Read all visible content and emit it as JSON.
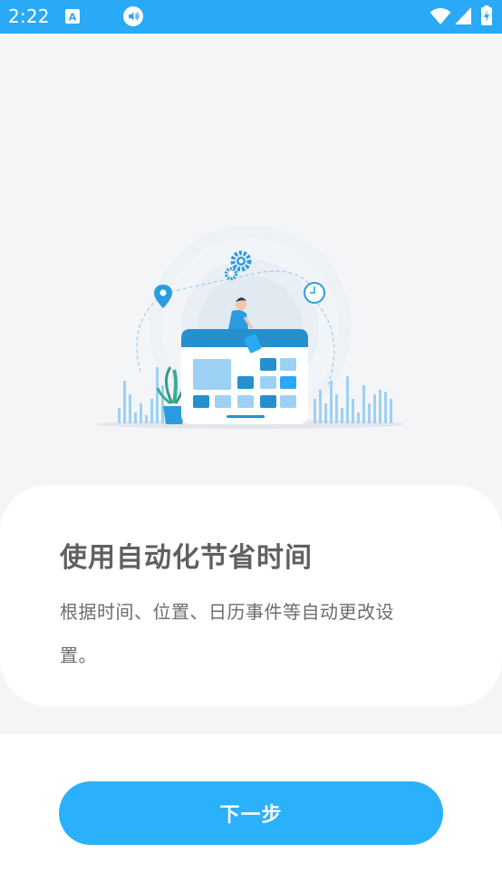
{
  "status_bar": {
    "time": "2:22",
    "icons": [
      "accessibility-a-icon",
      "volume-icon",
      "wifi-icon",
      "signal-icon",
      "battery-charging-icon"
    ],
    "background": "#2aa9f6"
  },
  "illustration": {
    "description_icons": [
      "location-pin-icon",
      "gear-icon",
      "clock-icon",
      "plant-icon",
      "person-icon",
      "dashboard-icon"
    ],
    "accent": "#2aa9f6"
  },
  "card": {
    "title": "使用自动化节省时间",
    "description": "根据时间、位置、日历事件等自动更改设置。"
  },
  "actions": {
    "next_label": "下一步",
    "button_color": "#2bb0fb"
  }
}
